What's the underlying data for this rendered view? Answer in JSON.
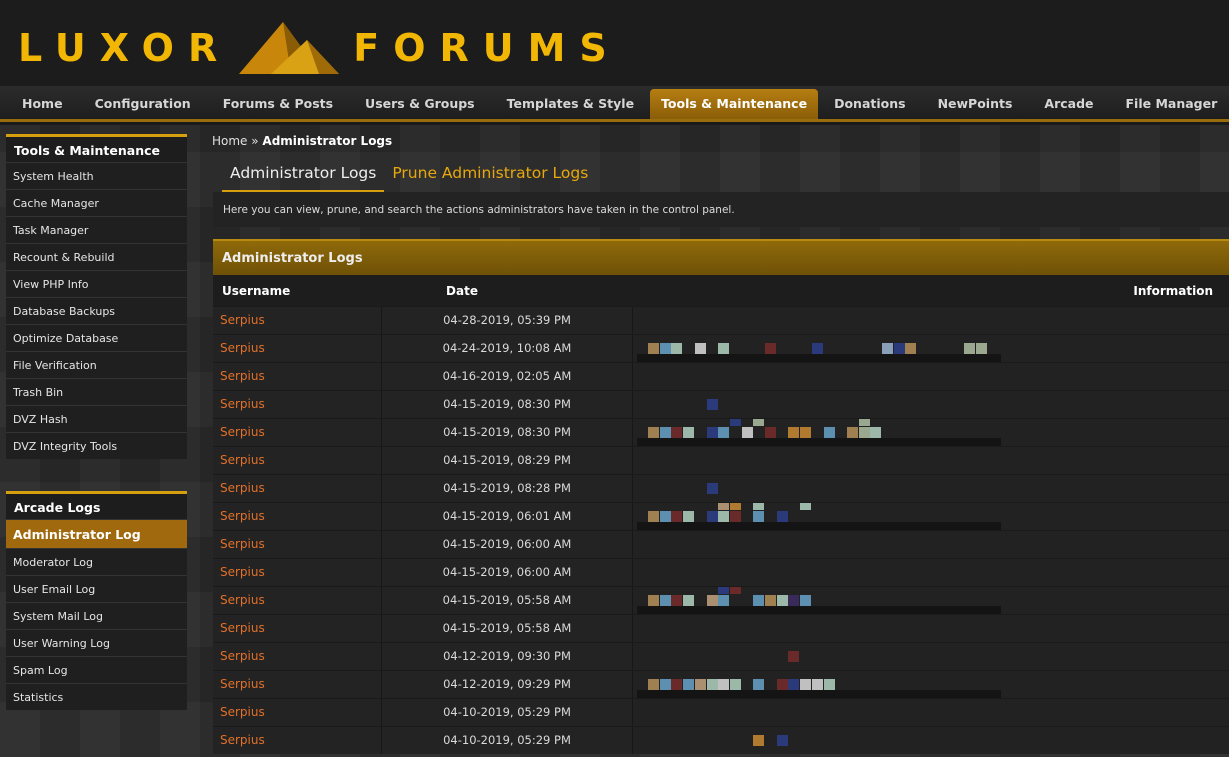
{
  "brand": {
    "left": "LUXOR",
    "right": "FORUMS"
  },
  "nav": [
    "Home",
    "Configuration",
    "Forums & Posts",
    "Users & Groups",
    "Templates & Style",
    "Tools & Maintenance",
    "Donations",
    "NewPoints",
    "Arcade",
    "File Manager"
  ],
  "nav_active": "Tools & Maintenance",
  "sidebar": {
    "group1": {
      "title": "Tools & Maintenance",
      "items": [
        "System Health",
        "Cache Manager",
        "Task Manager",
        "Recount & Rebuild",
        "View PHP Info",
        "Database Backups",
        "Optimize Database",
        "File Verification",
        "Trash Bin",
        "DVZ Hash",
        "DVZ Integrity Tools"
      ]
    },
    "group2": {
      "title": "Arcade Logs",
      "items": [
        "Administrator Log",
        "Moderator Log",
        "User Email Log",
        "System Mail Log",
        "User Warning Log",
        "Spam Log",
        "Statistics"
      ],
      "active": "Administrator Log"
    }
  },
  "breadcrumb": {
    "home": "Home",
    "sep": " » ",
    "current": "Administrator Logs"
  },
  "tabs": [
    "Administrator Logs",
    "Prune Administrator Logs"
  ],
  "description": "Here you can view, prune, and search the actions administrators have taken in the control panel.",
  "table": {
    "title": "Administrator Logs",
    "headers": {
      "username": "Username",
      "date": "Date",
      "information": "Information"
    },
    "rows": [
      {
        "user": "Serpius",
        "date": "04-28-2019, 05:39 PM"
      },
      {
        "user": "Serpius",
        "date": "04-24-2019, 10:08 AM"
      },
      {
        "user": "Serpius",
        "date": "04-16-2019, 02:05 AM"
      },
      {
        "user": "Serpius",
        "date": "04-15-2019, 08:30 PM"
      },
      {
        "user": "Serpius",
        "date": "04-15-2019, 08:30 PM"
      },
      {
        "user": "Serpius",
        "date": "04-15-2019, 08:29 PM"
      },
      {
        "user": "Serpius",
        "date": "04-15-2019, 08:28 PM"
      },
      {
        "user": "Serpius",
        "date": "04-15-2019, 06:01 AM"
      },
      {
        "user": "Serpius",
        "date": "04-15-2019, 06:00 AM"
      },
      {
        "user": "Serpius",
        "date": "04-15-2019, 06:00 AM"
      },
      {
        "user": "Serpius",
        "date": "04-15-2019, 05:58 AM"
      },
      {
        "user": "Serpius",
        "date": "04-15-2019, 05:58 AM"
      },
      {
        "user": "Serpius",
        "date": "04-12-2019, 09:30 PM"
      },
      {
        "user": "Serpius",
        "date": "04-12-2019, 09:29 PM"
      },
      {
        "user": "Serpius",
        "date": "04-10-2019, 05:29 PM"
      },
      {
        "user": "Serpius",
        "date": "04-10-2019, 05:29 PM"
      }
    ]
  },
  "colors": {
    "accent": "#d59f0e",
    "username": "#e2702a",
    "active_tab": "#a0690d"
  }
}
